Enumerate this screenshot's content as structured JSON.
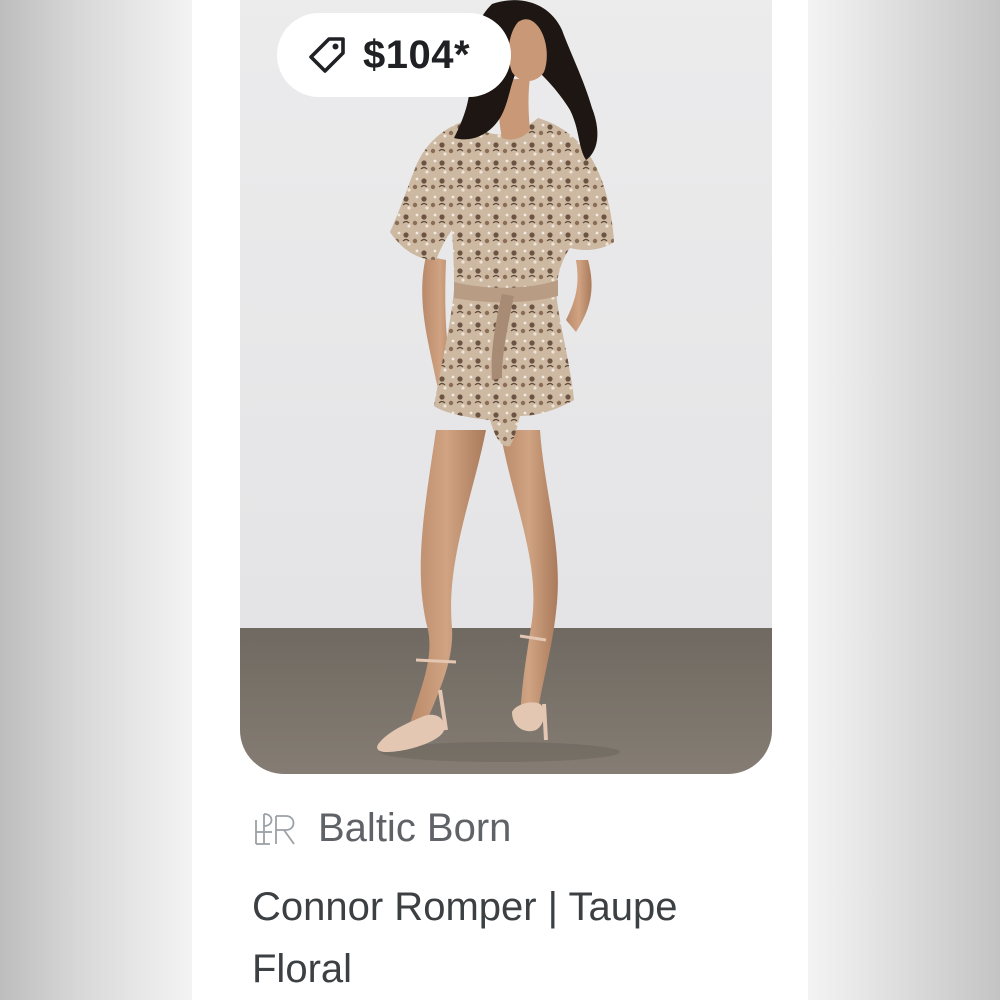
{
  "product": {
    "price": "$104*",
    "brand": "Baltic Born",
    "title": "Connor Romper | Taupe Floral",
    "image_alt": "Model wearing a taupe floral romper with short sleeves and tie waist, nude heels",
    "icons": {
      "price_tag": "price-tag-icon",
      "brand_logo": "baltic-born-logo"
    }
  },
  "colors": {
    "wall": "#e9e9ea",
    "floor": "#7d766e",
    "text_dark": "#3c4043",
    "text_muted": "#5f6368"
  }
}
